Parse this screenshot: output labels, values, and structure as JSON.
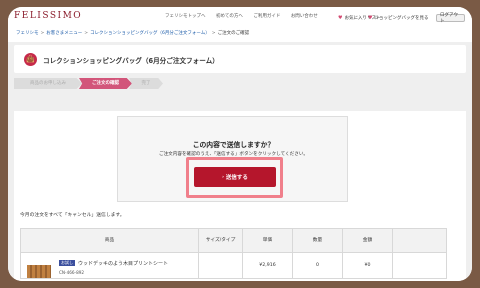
{
  "brand": {
    "logo": "FELISSIMO"
  },
  "header": {
    "links": [
      "フェリシモトップへ",
      "初めての方へ",
      "ご利用ガイド",
      "お問い合わせ"
    ],
    "favorites": "お気に入りリスト",
    "bag": "ショッピングバッグを見る",
    "logout": "ログアウト"
  },
  "breadcrumb": {
    "items": [
      "フェリシモ",
      "お客さまメニュー",
      "コレクションショッピングバッグ（6月分ご注文フォーム）"
    ],
    "current": "ご注文のご確認"
  },
  "page": {
    "title": "コレクションショッピングバッグ（6月分ご注文フォーム）"
  },
  "steps": [
    "商品のお申し込み",
    "ご注文の確認",
    "完了"
  ],
  "confirm": {
    "question": "この内容で送信しますか？",
    "note": "ご注文内容を確認のうえ、「送信する」ボタンをクリックしてください。",
    "button": "送信する"
  },
  "cancel_text": "今月の注文をすべて「キャンセル」送信します。",
  "table": {
    "headers": [
      "商品",
      "サイズ/タイプ",
      "単価",
      "数量",
      "金額"
    ],
    "rows": [
      {
        "badge": "お試し",
        "name": "ウッドデッキのよう木目プリントシート",
        "code": "CN-466-892",
        "size": "",
        "price": "¥2,916",
        "qty": "0",
        "amount": "¥0"
      }
    ]
  },
  "colors": {
    "brand": "#8b1d2c",
    "accent": "#b5162c",
    "step_active": "#d2557a",
    "highlight": "#f07f8b",
    "frame": "#7a5a45"
  }
}
